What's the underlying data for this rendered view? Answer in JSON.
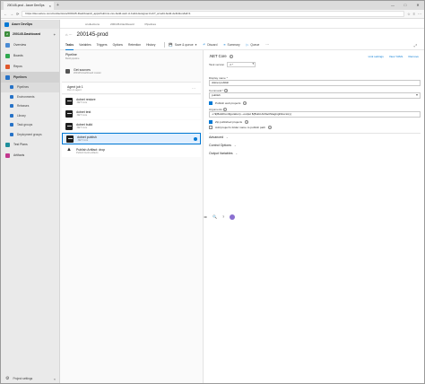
{
  "browser": {
    "tab_title": "200145-prod - Azure DevOps",
    "tab_close": "×",
    "new_tab": "+",
    "controls": [
      "—",
      "□",
      "✕"
    ],
    "nav": [
      "←",
      "→",
      "⟳"
    ],
    "url": "https://dev.azure.com/ccollections/200145-Dashboard/_apps/hub/ms.vss-build-web.ci-build-designer-hub?_a=edit-build-definition&id=1",
    "url_actions": [
      "☆",
      "≡",
      "⋯"
    ]
  },
  "sidebar": {
    "org": "Azure DevOps",
    "project": "200145-Dashboard",
    "project_initial": "2",
    "project_add": "+",
    "items": [
      {
        "label": "Overview",
        "color": "#4a8bd4"
      },
      {
        "label": "Boards",
        "color": "#2fa84f"
      },
      {
        "label": "Repos",
        "color": "#e0582c"
      },
      {
        "label": "Pipelines",
        "color": "#2672c7",
        "active": true
      }
    ],
    "subitems": [
      {
        "label": "Pipelines",
        "color": "#2672c7"
      },
      {
        "label": "Environments",
        "color": "#2672c7"
      },
      {
        "label": "Releases",
        "color": "#2672c7"
      },
      {
        "label": "Library",
        "color": "#2672c7"
      },
      {
        "label": "Task groups",
        "color": "#2672c7"
      },
      {
        "label": "Deployment groups",
        "color": "#2672c7"
      }
    ],
    "extra": [
      {
        "label": "Test Plans",
        "color": "#1f8f9c"
      },
      {
        "label": "Artifacts",
        "color": "#c2388f"
      }
    ],
    "footer_label": "Project settings",
    "footer_collapse": "«"
  },
  "topbar": {
    "breadcrumbs": [
      "ccollections",
      "200145-Dashboard",
      "Pipelines"
    ],
    "icons": [
      "≔",
      "🔍",
      "?"
    ]
  },
  "title": {
    "nav": "⌂ ···",
    "text": "200145-prod"
  },
  "toolbar": {
    "tabs": [
      "Tasks",
      "Variables",
      "Triggers",
      "Options",
      "Retention",
      "History"
    ],
    "actions": [
      {
        "icon": "💾",
        "label": "Save & queue",
        "caret": "▾"
      },
      {
        "icon": "↶",
        "label": "Discard"
      },
      {
        "icon": "≡",
        "label": "Summary"
      },
      {
        "icon": "▷",
        "label": "Queue"
      },
      {
        "icon": "⋯",
        "label": ""
      }
    ],
    "expand": "⤢"
  },
  "left": {
    "pipeline_title": "Pipeline",
    "pipeline_sub": "Build pipeline",
    "get_sources": "Get sources",
    "get_sources_sub": "200145-Dashboard  master",
    "job_title": "Agent job 1",
    "job_sub": "Run on agent",
    "job_menu": "⋯",
    "tasks": [
      {
        "name": ".NET Core",
        "title": "dotnet restore",
        "sub": ".NET Core"
      },
      {
        "name": ".NET Core",
        "title": "dotnet test",
        "sub": ".NET Core"
      },
      {
        "name": ".NET Core",
        "title": "dotnet build",
        "sub": ".NET Core"
      },
      {
        "name": ".NET Core",
        "title": "dotnet publish",
        "sub": ".NET Core",
        "selected": true
      },
      {
        "name": "Publish",
        "title": "Publish Artifact: drop",
        "sub": "Publish build artifacts"
      }
    ]
  },
  "details": {
    "heading": ".NET Core",
    "link_settings": "Link settings",
    "view_yaml": "View YAML",
    "remove": "Remove",
    "task_version_label": "Task version",
    "task_version": "2.*",
    "display_name_label": "Display name *",
    "display_name": "dotnet publish",
    "command_label": "Command *",
    "command": "publish",
    "publish_web_label": "Publish web projects",
    "arguments_label": "Arguments",
    "arguments": "-c $(BuildConfiguration) --output $(Build.ArtifactStagingDirectory)",
    "zip_label": "Zip published projects",
    "add_folder_label": "Add project's folder name to publish path",
    "sections": [
      "Advanced",
      "Control Options",
      "Output Variables"
    ],
    "caret": "⌄",
    "info": "i"
  }
}
